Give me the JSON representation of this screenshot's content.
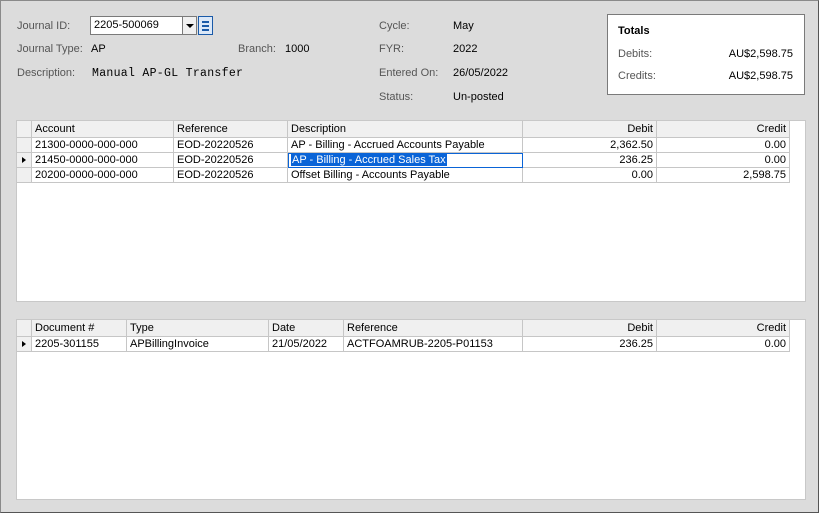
{
  "header": {
    "journal_id_label": "Journal ID:",
    "journal_id_value": "2205-500069",
    "journal_type_label": "Journal Type:",
    "journal_type_value": "AP",
    "branch_label": "Branch:",
    "branch_value": "1000",
    "description_label": "Description:",
    "description_value": "Manual AP-GL Transfer",
    "cycle_label": "Cycle:",
    "cycle_value": "May",
    "fyr_label": "FYR:",
    "fyr_value": "2022",
    "entered_on_label": "Entered On:",
    "entered_on_value": "26/05/2022",
    "status_label": "Status:",
    "status_value": "Un-posted"
  },
  "totals": {
    "title": "Totals",
    "debits_label": "Debits:",
    "debits_value": "AU$2,598.75",
    "credits_label": "Credits:",
    "credits_value": "AU$2,598.75"
  },
  "lines_grid": {
    "columns": [
      "Account",
      "Reference",
      "Description",
      "Debit",
      "Credit"
    ],
    "rows": [
      {
        "account": "21300-0000-000-000",
        "reference": "EOD-20220526",
        "description": "AP - Billing - Accrued Accounts Payable",
        "debit": "2,362.50",
        "credit": "0.00",
        "current": false
      },
      {
        "account": "21450-0000-000-000",
        "reference": "EOD-20220526",
        "description": "AP - Billing - Accrued Sales Tax",
        "debit": "236.25",
        "credit": "0.00",
        "current": true
      },
      {
        "account": "20200-0000-000-000",
        "reference": "EOD-20220526",
        "description": "Offset Billing - Accounts Payable",
        "debit": "0.00",
        "credit": "2,598.75",
        "current": false
      }
    ]
  },
  "docs_grid": {
    "columns": [
      "Document #",
      "Type",
      "Date",
      "Reference",
      "Debit",
      "Credit"
    ],
    "rows": [
      {
        "document": "2205-301155",
        "type": "APBillingInvoice",
        "date": "21/05/2022",
        "reference": "ACTFOAMRUB-2205-P01153",
        "debit": "236.25",
        "credit": "0.00",
        "current": true
      }
    ]
  },
  "icons": {
    "dropdown": "chevron-down-icon",
    "list": "list-icon",
    "row_pointer": "row-pointer-icon"
  },
  "colors": {
    "background": "#dcdcdc",
    "selection": "#0a64d7",
    "accent": "#1a5aa8"
  }
}
